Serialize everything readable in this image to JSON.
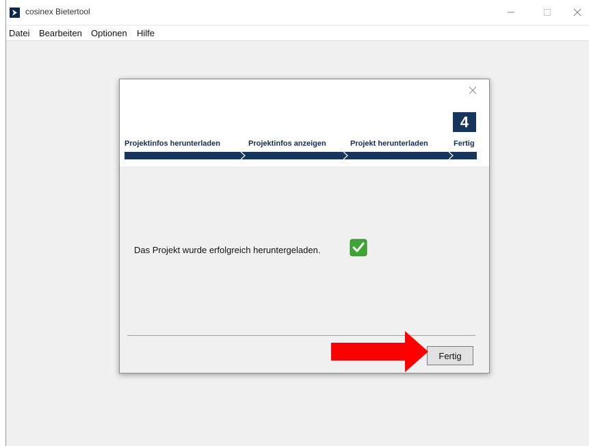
{
  "window": {
    "title": "cosinex Bietertool",
    "controls": {
      "minimize": "minimize-icon",
      "maximize": "maximize-icon",
      "close": "close-icon"
    }
  },
  "menu": {
    "items": [
      "Datei",
      "Bearbeiten",
      "Optionen",
      "Hilfe"
    ]
  },
  "dialog": {
    "close_icon": "close-icon",
    "current_step": "4",
    "steps": [
      {
        "label": "Projektinfos herunterladen"
      },
      {
        "label": "Projektinfos anzeigen"
      },
      {
        "label": "Projekt herunterladen"
      },
      {
        "label": "Fertig"
      }
    ],
    "message": "Das Projekt wurde erfolgreich heruntergeladen.",
    "status_icon": "checkmark-icon",
    "finish_label": "Fertig"
  },
  "annotation": {
    "arrow_icon": "red-arrow-icon",
    "color": "#ff0000"
  },
  "colors": {
    "step_bar": "#17365d",
    "step_text": "#0f2d5a",
    "check_green": "#3ca534"
  }
}
